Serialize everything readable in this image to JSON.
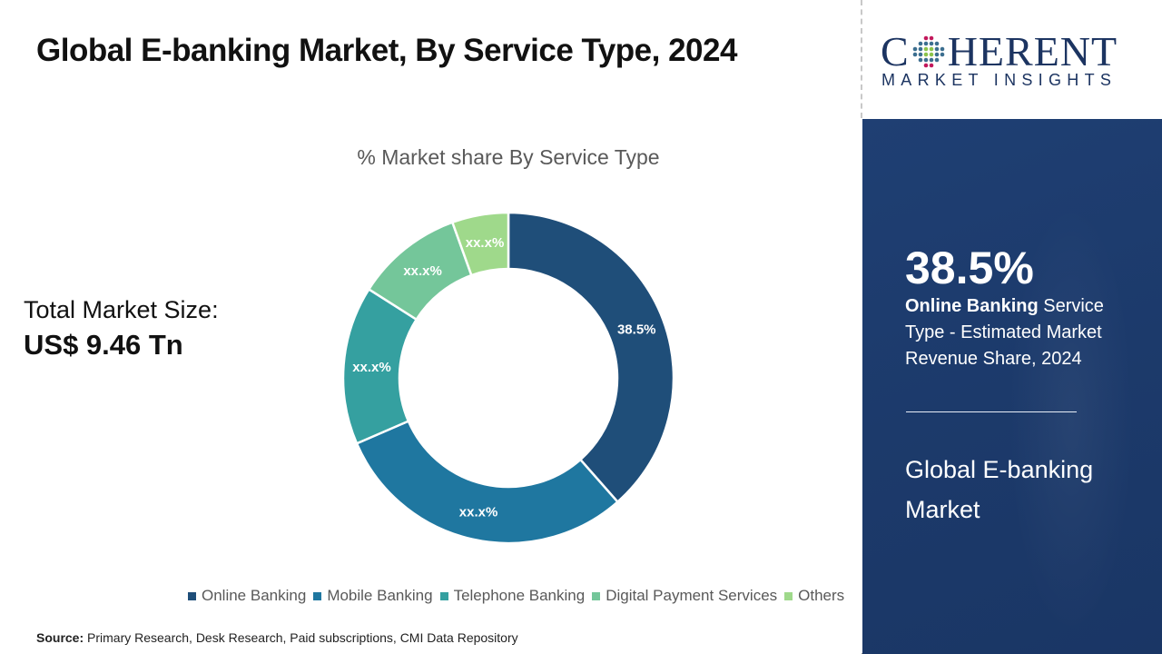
{
  "header": {
    "title": "Global E-banking Market, By Service Type, 2024"
  },
  "summary": {
    "total_label": "Total Market Size:",
    "total_value": "US$ 9.46 Tn"
  },
  "chart_data": {
    "type": "pie",
    "variant": "donut",
    "title": "% Market share By Service Type",
    "categories": [
      "Online Banking",
      "Mobile Banking",
      "Telephone Banking",
      "Digital Payment Services",
      "Others"
    ],
    "values": [
      38.5,
      30.0,
      15.5,
      10.5,
      5.5
    ],
    "data_labels": [
      "38.5%",
      "xx.x%",
      "xx.x%",
      "xx.x%",
      "xx.x%"
    ],
    "colors": [
      "#1f4e79",
      "#1f77a0",
      "#35a0a0",
      "#74c69a",
      "#9fd98b"
    ],
    "legend_position": "bottom",
    "start_angle_deg": 0,
    "direction": "clockwise"
  },
  "legend": [
    {
      "label": "Online Banking",
      "color": "#1f4e79"
    },
    {
      "label": "Mobile Banking",
      "color": "#1f77a0"
    },
    {
      "label": "Telephone Banking",
      "color": "#35a0a0"
    },
    {
      "label": "Digital Payment Services",
      "color": "#74c69a"
    },
    {
      "label": "Others",
      "color": "#9fd98b"
    }
  ],
  "footer": {
    "source_label": "Source:",
    "source_text": " Primary Research, Desk Research, Paid subscriptions, CMI Data Repository"
  },
  "brand": {
    "logo_left": "C",
    "logo_right": "HERENT",
    "logo_sub": "MARKET INSIGHTS",
    "color": "#1c3461"
  },
  "sidepanel": {
    "highlight_value": "38.5%",
    "highlight_bold": "Online Banking",
    "highlight_text": " Service Type - Estimated Market Revenue Share, 2024",
    "market_name": "Global E-banking Market",
    "bg_color": "#1d3b6c"
  }
}
